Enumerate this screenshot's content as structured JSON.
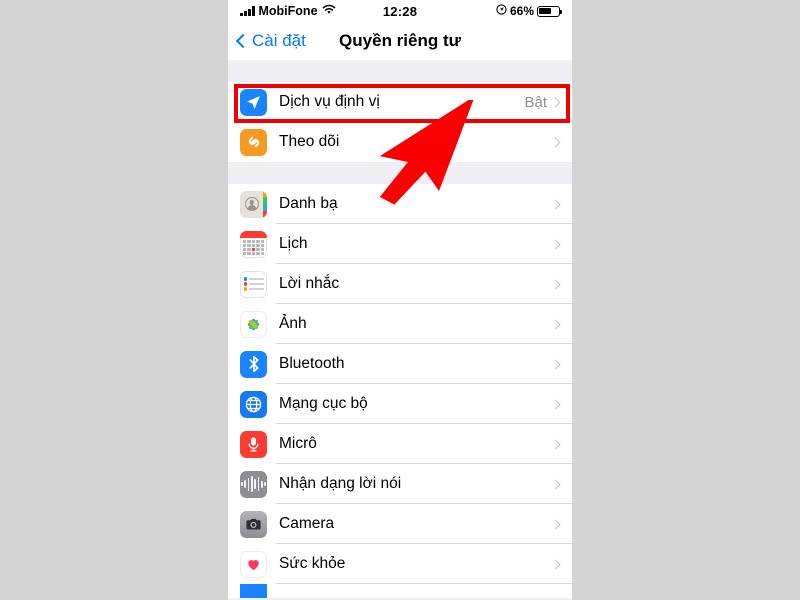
{
  "statusbar": {
    "carrier": "MobiFone",
    "time": "12:28",
    "battery_percent": "66%",
    "signal_icon": "signal-bars-icon",
    "wifi_icon": "wifi-icon",
    "location_indicator_icon": "location-arrow-indicator-icon",
    "battery_icon": "battery-icon"
  },
  "navbar": {
    "back_label": "Cài đặt",
    "title": "Quyền riêng tư",
    "back_icon": "chevron-left-icon"
  },
  "sections": [
    {
      "rows": [
        {
          "label": "Dịch vụ định vị",
          "value": "Bật",
          "icon": "location-services-icon",
          "highlighted": true
        },
        {
          "label": "Theo dõi",
          "value": "",
          "icon": "tracking-icon",
          "highlighted": false
        }
      ]
    },
    {
      "rows": [
        {
          "label": "Danh bạ",
          "value": "",
          "icon": "contacts-icon",
          "highlighted": false
        },
        {
          "label": "Lịch",
          "value": "",
          "icon": "calendar-icon",
          "highlighted": false
        },
        {
          "label": "Lời nhắc",
          "value": "",
          "icon": "reminders-icon",
          "highlighted": false
        },
        {
          "label": "Ảnh",
          "value": "",
          "icon": "photos-icon",
          "highlighted": false
        },
        {
          "label": "Bluetooth",
          "value": "",
          "icon": "bluetooth-icon",
          "highlighted": false
        },
        {
          "label": "Mạng cục bộ",
          "value": "",
          "icon": "local-network-icon",
          "highlighted": false
        },
        {
          "label": "Micrô",
          "value": "",
          "icon": "microphone-icon",
          "highlighted": false
        },
        {
          "label": "Nhận dạng lời nói",
          "value": "",
          "icon": "speech-recognition-icon",
          "highlighted": false
        },
        {
          "label": "Camera",
          "value": "",
          "icon": "camera-icon",
          "highlighted": false
        },
        {
          "label": "Sức khỏe",
          "value": "",
          "icon": "health-icon",
          "highlighted": false
        }
      ]
    }
  ],
  "annotations": {
    "highlight_color": "#f00000",
    "arrow_color": "#fb0000",
    "arrow_name": "red-pointer-arrow",
    "highlight_target": "Dịch vụ định vị"
  },
  "colors": {
    "page_background": "#d4d4d4",
    "list_background": "#efeff4",
    "accent_blue": "#007aff"
  }
}
